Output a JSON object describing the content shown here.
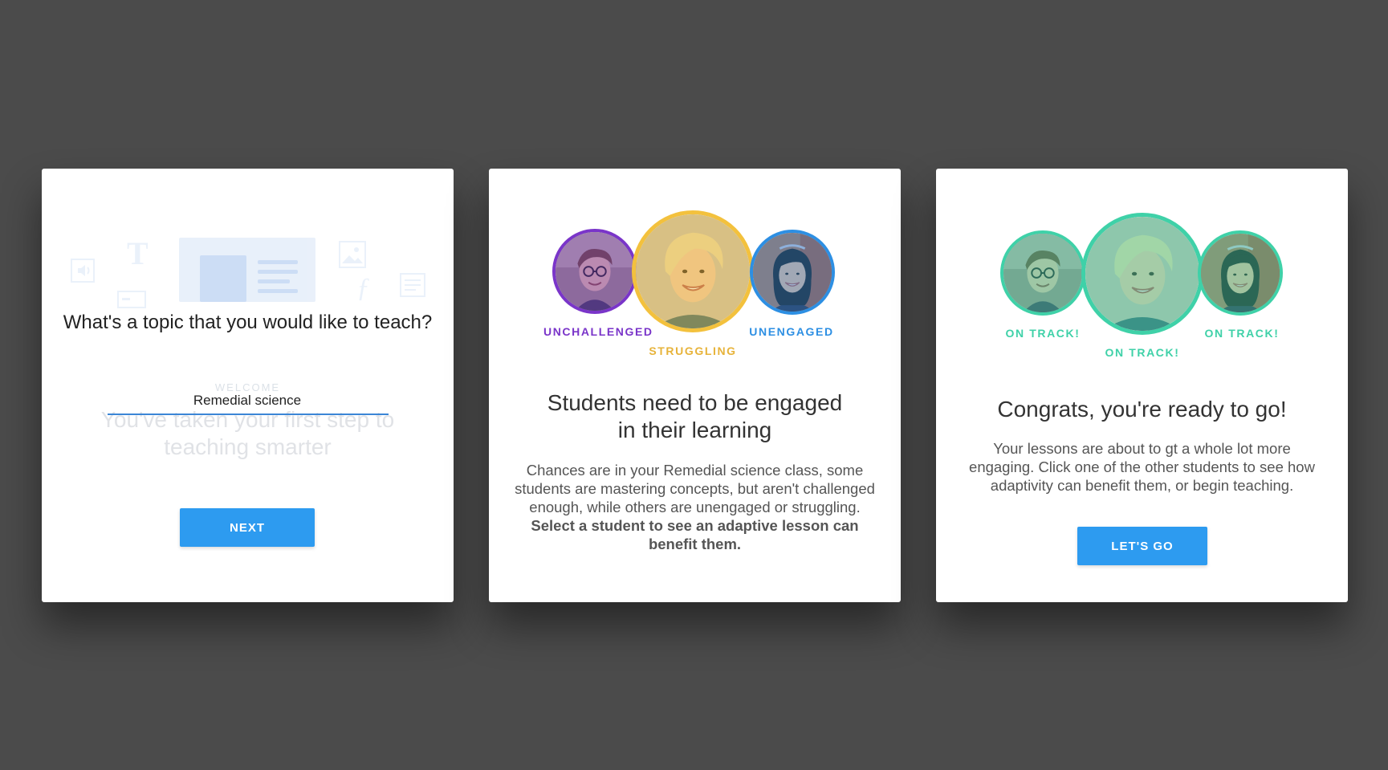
{
  "colors": {
    "background": "#4b4b4b",
    "primary_button": "#2d9bf0",
    "unchallenged": "#7a35c9",
    "struggling": "#f3c13d",
    "unengaged": "#2d8fe3",
    "on_track": "#3fd1a8"
  },
  "card1": {
    "question": "What's a topic that you would like to teach?",
    "input_value": "Remedial science",
    "ghost_welcome": "WELCOME",
    "ghost_subtitle": "You've taken your first step to teaching smarter",
    "ghost_text_glyph": "T",
    "ghost_formula_glyph": "ƒ",
    "next_label": "NEXT"
  },
  "card2": {
    "students": [
      {
        "name": "student-glasses",
        "status": "UNCHALLENGED"
      },
      {
        "name": "student-blonde",
        "status": "STRUGGLING"
      },
      {
        "name": "student-dark-hair",
        "status": "UNENGAGED"
      }
    ],
    "title": "Students need to be engaged in their learning",
    "body": "Chances are in your Remedial science class, some students are mastering concepts, but aren't challenged enough, while others are unengaged or struggling.",
    "body_bold": "Select a student to see an adaptive lesson can benefit them."
  },
  "card3": {
    "students": [
      {
        "name": "student-glasses",
        "status": "ON TRACK!"
      },
      {
        "name": "student-blonde",
        "status": "ON TRACK!"
      },
      {
        "name": "student-dark-hair",
        "status": "ON TRACK!"
      }
    ],
    "title": "Congrats, you're ready to go!",
    "body": "Your lessons are about to gt a whole lot more engaging. Click one of the other students to see how adaptivity can benefit them, or begin teaching.",
    "button_label": "LET'S GO"
  }
}
